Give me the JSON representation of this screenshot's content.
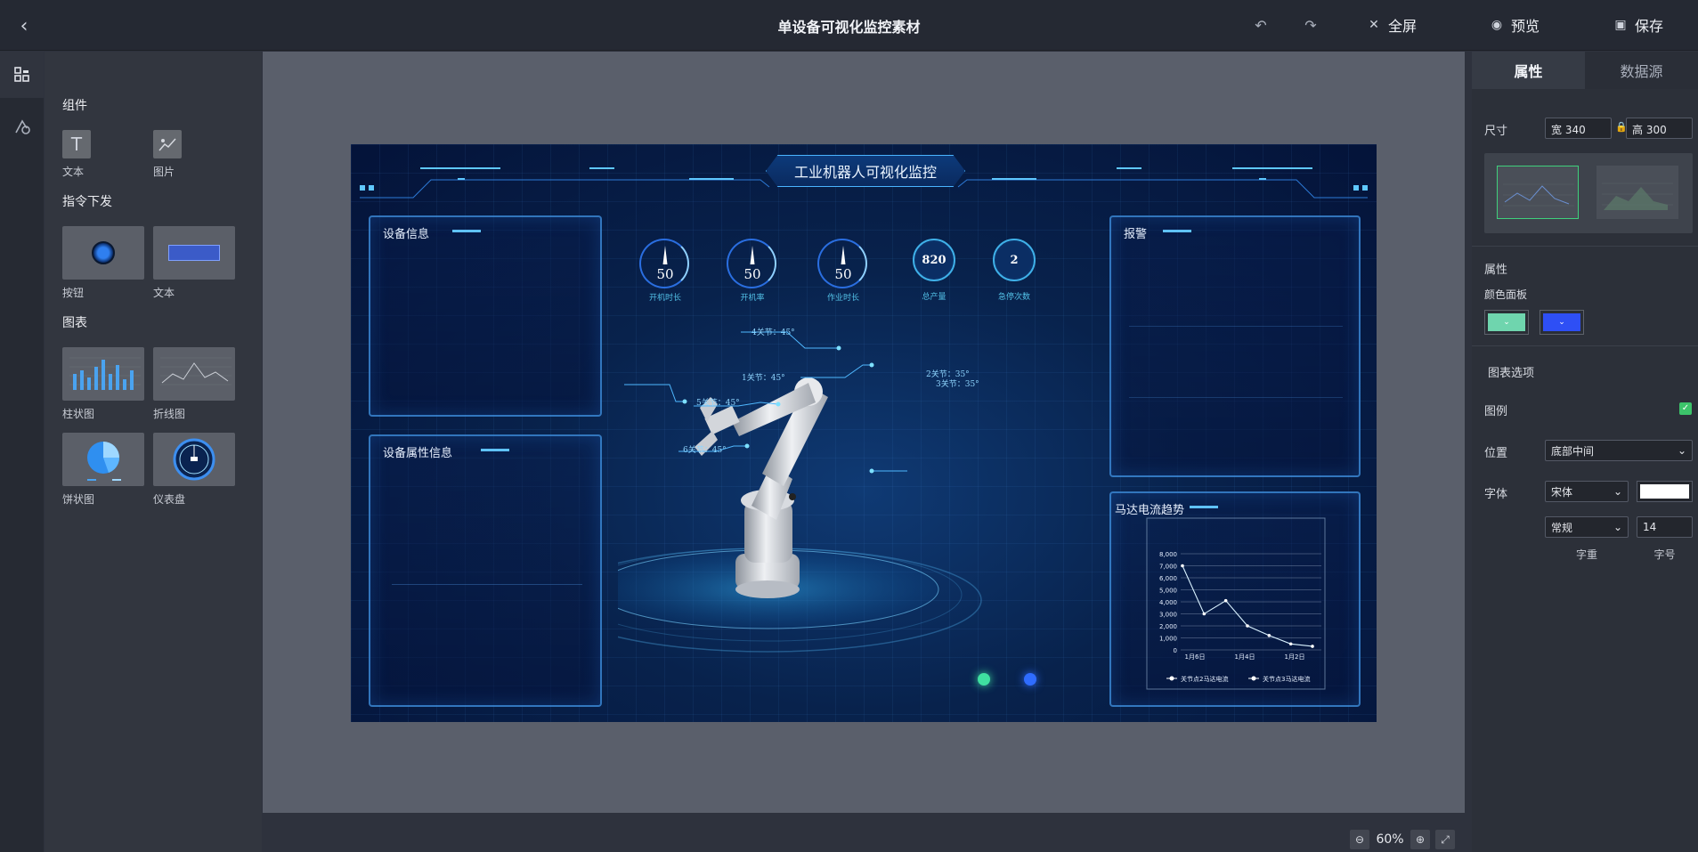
{
  "header": {
    "back_icon": "chevron-left-icon",
    "title": "单设备可视化监控素材",
    "undo_icon": "undo-icon",
    "redo_icon": "redo-icon",
    "fullscreen_label": "全屏",
    "preview_label": "预览",
    "save_label": "保存"
  },
  "rail": {
    "items": [
      {
        "icon": "components-grid-icon",
        "active": true
      },
      {
        "icon": "shapes-icon",
        "active": false
      }
    ]
  },
  "left_panel": {
    "sections": [
      {
        "title": "组件",
        "items": [
          {
            "label": "文本",
            "icon": "text-icon"
          },
          {
            "label": "图片",
            "icon": "image-icon"
          }
        ]
      },
      {
        "title": "指令下发",
        "items": [
          {
            "label": "按钮",
            "icon": "button-icon"
          },
          {
            "label": "文本",
            "icon": "text-input-icon"
          }
        ]
      },
      {
        "title": "图表",
        "items": [
          {
            "label": "柱状图",
            "icon": "bar-chart-icon"
          },
          {
            "label": "折线图",
            "icon": "line-chart-icon"
          },
          {
            "label": "饼状图",
            "icon": "pie-chart-icon"
          },
          {
            "label": "仪表盘",
            "icon": "gauge-icon"
          }
        ]
      }
    ]
  },
  "dashboard": {
    "title": "工业机器人可视化监控",
    "panels": {
      "device_info": "设备信息",
      "device_attr": "设备属性信息",
      "alarm": "报警",
      "motor_trend": "马达电流趋势"
    },
    "gauges": [
      {
        "value": "50",
        "label": "开机时长"
      },
      {
        "value": "50",
        "label": "开机率"
      },
      {
        "value": "50",
        "label": "作业时长"
      }
    ],
    "counters": [
      {
        "value": "820",
        "label": "总产量"
      },
      {
        "value": "2",
        "label": "急停次数"
      }
    ],
    "joints": {
      "j1": "1关节：45°",
      "j2": "2关节：35°",
      "j3": "3关节：35°",
      "j4": "4关节：45°",
      "j5": "5关节：45°",
      "j6": "6关节：45°"
    },
    "status_colors": [
      "#3fe0a0",
      "#2f6cff"
    ]
  },
  "chart_data": {
    "type": "line",
    "categories": [
      "1月6日",
      "1月4日",
      "1月2日"
    ],
    "x": [
      0,
      1,
      2,
      3,
      4,
      5,
      6
    ],
    "yticks": [
      "8,000",
      "7,000",
      "6,000",
      "5,000",
      "4,000",
      "3,000",
      "2,000",
      "1,000",
      "0"
    ],
    "ylim": [
      0,
      8000
    ],
    "series": [
      {
        "name": "关节点2马达电流",
        "values": [
          7000,
          3000,
          4100,
          2000,
          1200,
          500,
          300
        ]
      },
      {
        "name": "关节点3马达电流",
        "values": []
      }
    ],
    "legend": "bottom-center",
    "grid": true
  },
  "right_panel": {
    "tabs": [
      "属性",
      "数据源"
    ],
    "size_label": "尺寸",
    "width_value": "宽 340",
    "height_value": "高 300",
    "lock_icon": "lock-icon",
    "attr_title": "属性",
    "color_panel_label": "颜色面板",
    "color_swatches": [
      "#6fd5ae",
      "#2e4ff5"
    ],
    "chart_options_title": "图表选项",
    "legend_label": "图例",
    "legend_checked": true,
    "position_label": "位置",
    "position_value": "底部中间",
    "font_label": "字体",
    "font_value": "宋体",
    "font_color": "#ffffff",
    "weight_value": "常规",
    "size_value": "14",
    "weight_caption": "字重",
    "size_caption": "字号"
  },
  "zoom": {
    "value": "60%"
  }
}
